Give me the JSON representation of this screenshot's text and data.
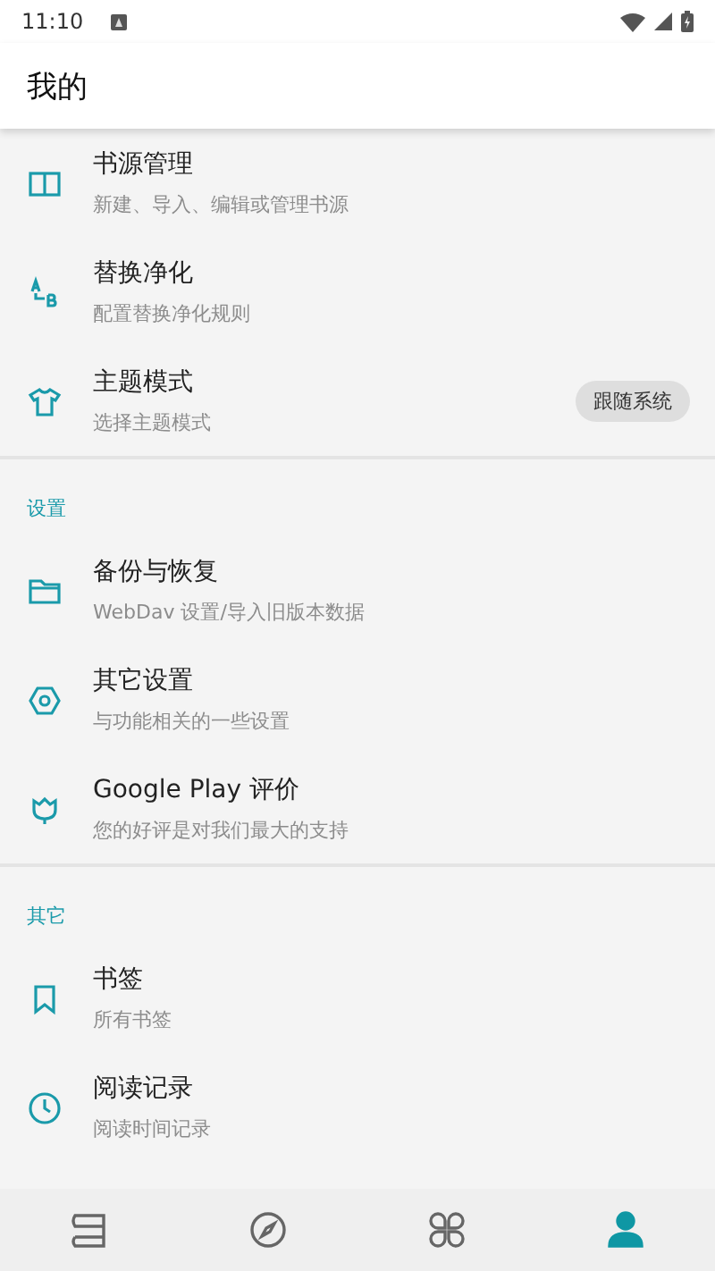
{
  "status_bar": {
    "time": "11:10"
  },
  "app_bar": {
    "title": "我的"
  },
  "sections": [
    {
      "items": [
        {
          "kind": "book",
          "title": "书源管理",
          "subtitle": "新建、导入、编辑或管理书源"
        },
        {
          "kind": "replace",
          "title": "替换净化",
          "subtitle": "配置替换净化规则"
        },
        {
          "kind": "shirt",
          "title": "主题模式",
          "subtitle": "选择主题模式",
          "chip": "跟随系统"
        }
      ]
    },
    {
      "header": "设置",
      "items": [
        {
          "kind": "folder",
          "title": "备份与恢复",
          "subtitle": "WebDav 设置/导入旧版本数据"
        },
        {
          "kind": "hexagon",
          "title": "其它设置",
          "subtitle": "与功能相关的一些设置"
        },
        {
          "kind": "flower",
          "title": "Google Play 评价",
          "subtitle": "您的好评是对我们最大的支持"
        }
      ]
    },
    {
      "header": "其它",
      "items": [
        {
          "kind": "bookmark",
          "title": "书签",
          "subtitle": "所有书签"
        },
        {
          "kind": "clock",
          "title": "阅读记录",
          "subtitle": "阅读时间记录"
        }
      ]
    }
  ],
  "bottom_nav": [
    {
      "kind": "books",
      "selected": false
    },
    {
      "kind": "compass",
      "selected": false
    },
    {
      "kind": "clover",
      "selected": false
    },
    {
      "kind": "person",
      "selected": true
    }
  ]
}
